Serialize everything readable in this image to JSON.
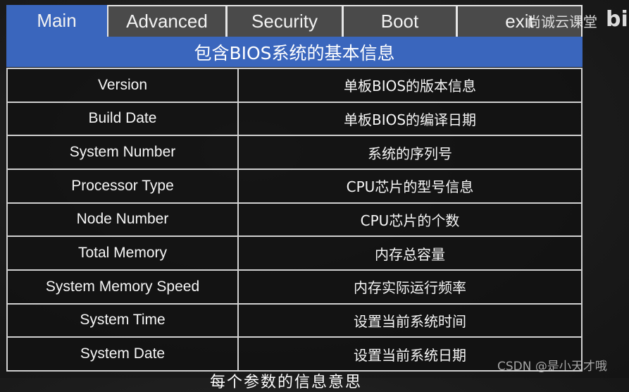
{
  "tabs": [
    {
      "label": "Main",
      "active": true
    },
    {
      "label": "Advanced",
      "active": false
    },
    {
      "label": "Security",
      "active": false
    },
    {
      "label": "Boot",
      "active": false
    },
    {
      "label": "exit",
      "active": false
    }
  ],
  "header": {
    "title": "包含BIOS系统的基本信息"
  },
  "table": {
    "rows": [
      {
        "key": "Version",
        "value": "单板BIOS的版本信息"
      },
      {
        "key": "Build Date",
        "value": "单板BIOS的编译日期"
      },
      {
        "key": "System Number",
        "value": "系统的序列号"
      },
      {
        "key": "Processor Type",
        "value": "CPU芯片的型号信息"
      },
      {
        "key": "Node Number",
        "value": "CPU芯片的个数"
      },
      {
        "key": "Total Memory",
        "value": "内存总容量"
      },
      {
        "key": "System Memory Speed",
        "value": "内存实际运行频率"
      },
      {
        "key": "System Time",
        "value": "设置当前系统时间"
      },
      {
        "key": "System Date",
        "value": "设置当前系统日期"
      }
    ]
  },
  "overlays": {
    "watermark_top": "尚诚云课堂",
    "logo": "bil",
    "watermark_bottom": "CSDN @是小天才哦",
    "caption": "每个参数的信息意思"
  },
  "colors": {
    "accent": "#3a66bd",
    "tab_inactive": "#4a4a4a",
    "border": "#d0d0d0"
  }
}
